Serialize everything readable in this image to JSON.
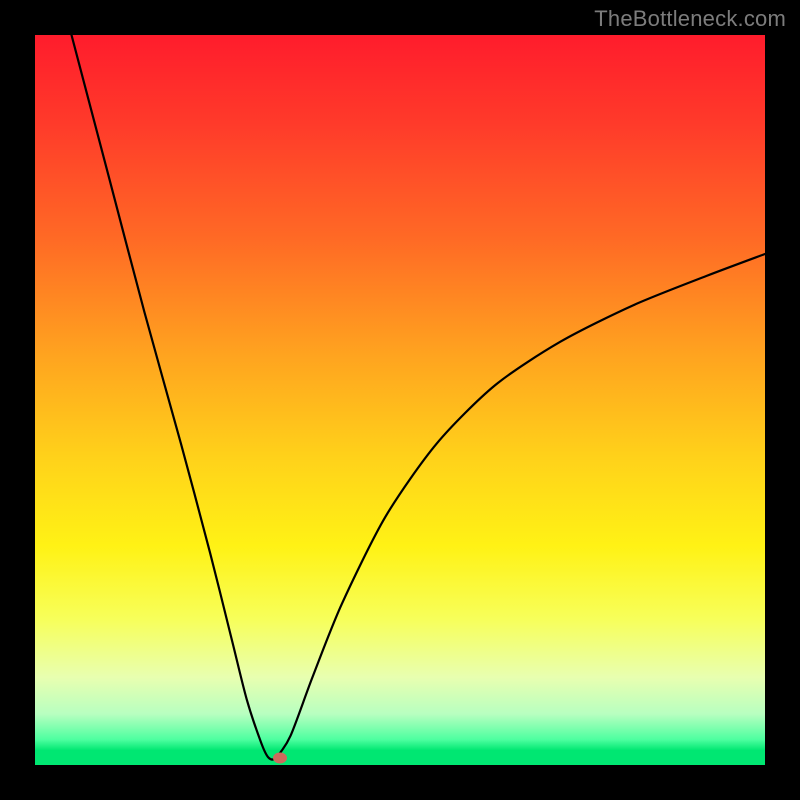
{
  "watermark": "TheBottleneck.com",
  "chart_data": {
    "type": "line",
    "title": "",
    "xlabel": "",
    "ylabel": "",
    "xlim": [
      0,
      100
    ],
    "ylim": [
      0,
      100
    ],
    "grid": false,
    "series": [
      {
        "name": "curve",
        "x": [
          5,
          10,
          15,
          20,
          24,
          27,
          29,
          31,
          32,
          33,
          35,
          38,
          42,
          48,
          55,
          63,
          72,
          82,
          92,
          100
        ],
        "values": [
          100,
          81,
          62,
          44,
          29,
          17,
          9,
          3,
          1,
          1,
          4,
          12,
          22,
          34,
          44,
          52,
          58,
          63,
          67,
          70
        ]
      }
    ],
    "annotations": [
      {
        "name": "marker",
        "x": 33.5,
        "y": 1
      }
    ],
    "background_gradient": {
      "top": "#ff1c2c",
      "mid": "#fff215",
      "bottom": "#00e772"
    }
  }
}
